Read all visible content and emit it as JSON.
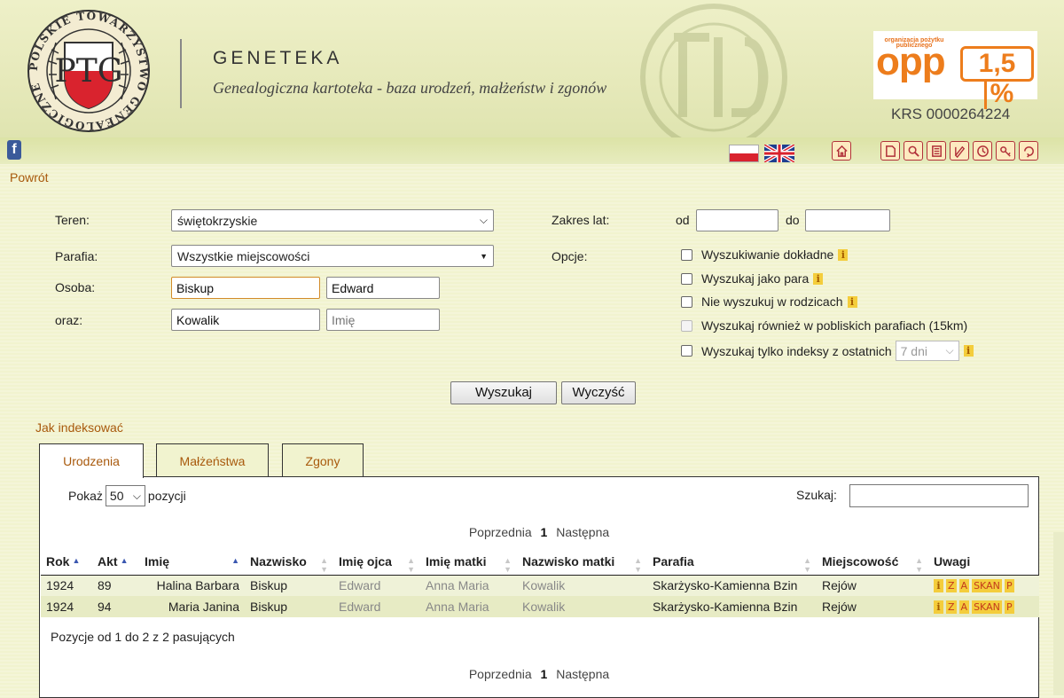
{
  "header": {
    "title": "GENETEKA",
    "subtitle": "Genealogiczna kartoteka - baza urodzeń, małżeństw i zgonów",
    "logo_monogram": "PTG",
    "opp": {
      "small": "organizacja pożytku publicznego",
      "word": "opp",
      "percent_num": "1,5",
      "percent_sign": "%"
    },
    "krs": "KRS 0000264224"
  },
  "toolbar": {
    "facebook": "f",
    "icons": [
      "home-icon",
      "book-icon",
      "search-icon",
      "list-icon",
      "notepad-icon",
      "clock-icon",
      "key-icon",
      "refresh-icon"
    ]
  },
  "nav": {
    "back": "Powrót",
    "how_to_index": "Jak indeksować"
  },
  "form": {
    "teren_label": "Teren:",
    "teren_value": "świętokrzyskie",
    "parafia_label": "Parafia:",
    "parafia_value": "Wszystkie miejscowości",
    "osoba_label": "Osoba:",
    "osoba_surname": "Biskup",
    "osoba_name": "Edward",
    "oraz_label": "oraz:",
    "oraz_surname": "Kowalik",
    "oraz_name_placeholder": "Imię",
    "zakres_label": "Zakres lat:",
    "od_label": "od",
    "do_label": "do",
    "opcje_label": "Opcje:",
    "options": [
      "Wyszukiwanie dokładne",
      "Wyszukaj jako para",
      "Nie wyszukuj w rodzicach",
      "Wyszukaj również w pobliskich parafiach (15km)",
      "Wyszukaj tylko indeksy z ostatnich"
    ],
    "days_value": "7 dni",
    "search_button": "Wyszukaj",
    "clear_button": "Wyczyść"
  },
  "tabs": [
    "Urodzenia",
    "Małżeństwa",
    "Zgony"
  ],
  "results": {
    "show_label": "Pokaż",
    "show_value": "50",
    "show_suffix": "pozycji",
    "search_label": "Szukaj:",
    "pager_prev": "Poprzednia",
    "pager_current": "1",
    "pager_next": "Następna",
    "columns": [
      "Rok",
      "Akt",
      "Imię",
      "Nazwisko",
      "Imię ojca",
      "Imię matki",
      "Nazwisko matki",
      "Parafia",
      "Miejscowość",
      "Uwagi"
    ],
    "rows": [
      {
        "rok": "1924",
        "akt": "89",
        "imie": "Halina Barbara",
        "nazwisko": "Biskup",
        "imie_ojca": "Edward",
        "imie_matki": "Anna Maria",
        "nazwisko_matki": "Kowalik",
        "parafia": "Skarżysko-Kamienna Bzin",
        "miejscowosc": "Rejów"
      },
      {
        "rok": "1924",
        "akt": "94",
        "imie": "Maria Janina",
        "nazwisko": "Biskup",
        "imie_ojca": "Edward",
        "imie_matki": "Anna Maria",
        "nazwisko_matki": "Kowalik",
        "parafia": "Skarżysko-Kamienna Bzin",
        "miejscowosc": "Rejów"
      }
    ],
    "note_badges": [
      "i",
      "Z",
      "A",
      "SKAN",
      "P"
    ],
    "summary": "Pozycje od 1 do 2 z 2 pasujących"
  },
  "colors": {
    "background": "#f1f3cf",
    "link": "#a8590c",
    "accent_orange": "#ed7d1c",
    "icon_border": "#b1323a",
    "row_odd": "#eff2d8",
    "row_even": "#e7ebc4"
  }
}
